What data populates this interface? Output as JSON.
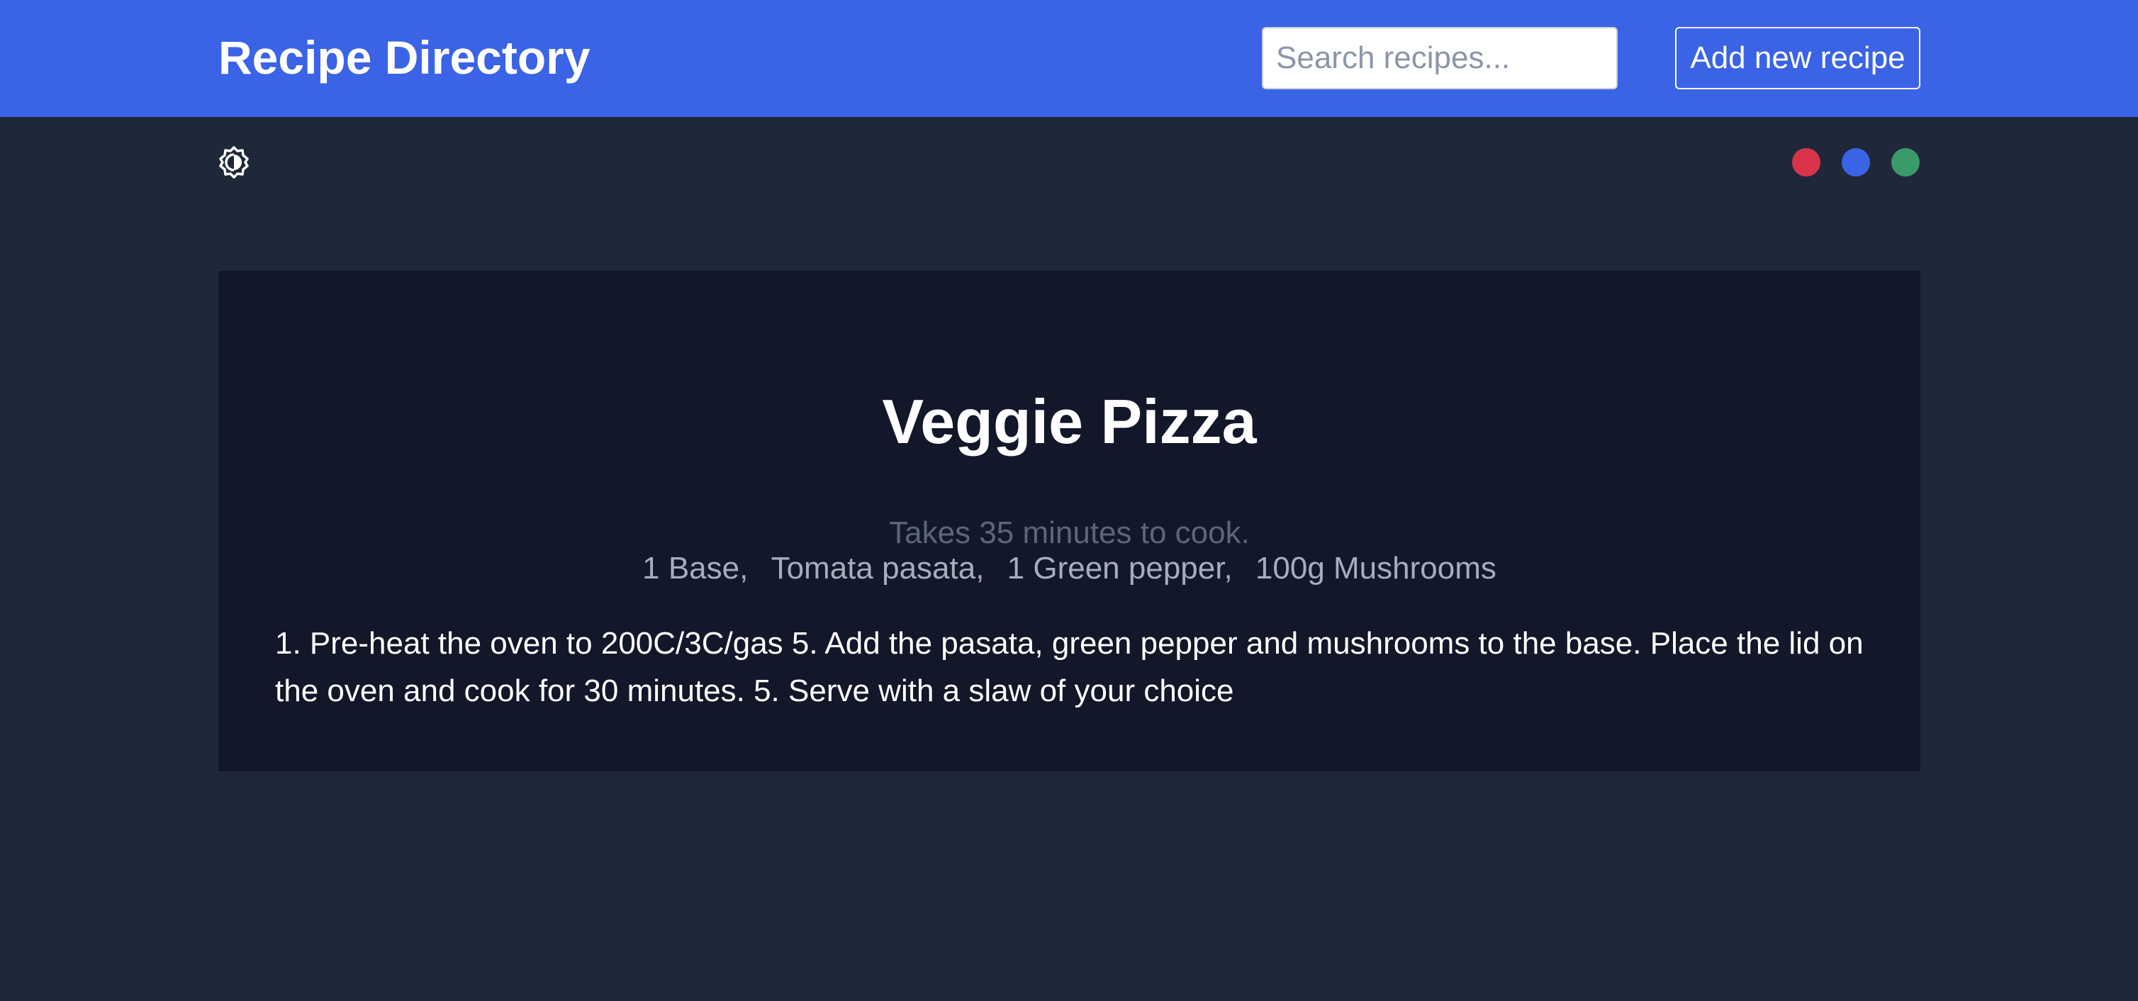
{
  "header": {
    "title": "Recipe Directory",
    "search_placeholder": "Search recipes...",
    "search_value": "",
    "add_button_label": "Add new recipe"
  },
  "toolbar": {
    "theme_toggle_icon": "contrast-toggle-icon",
    "color_swatches": [
      {
        "name": "red",
        "color": "#d9354a"
      },
      {
        "name": "blue",
        "color": "#3a63e6"
      },
      {
        "name": "green",
        "color": "#3b9a6a"
      }
    ]
  },
  "recipe": {
    "title": "Veggie Pizza",
    "cook_time": "Takes 35 minutes to cook.",
    "ingredients": [
      "1 Base,",
      "Tomata pasata,",
      "1 Green pepper,",
      "100g Mushrooms"
    ],
    "method": "1. Pre-heat the oven to 200C/3C/gas 5. Add the pasata, green pepper and mushrooms to the base. Place the lid on the oven and cook for 30 minutes. 5. Serve with a slaw of your choice"
  },
  "colors": {
    "header_bg": "#3a63e6",
    "page_bg": "#1f2839",
    "card_bg": "#121729"
  }
}
